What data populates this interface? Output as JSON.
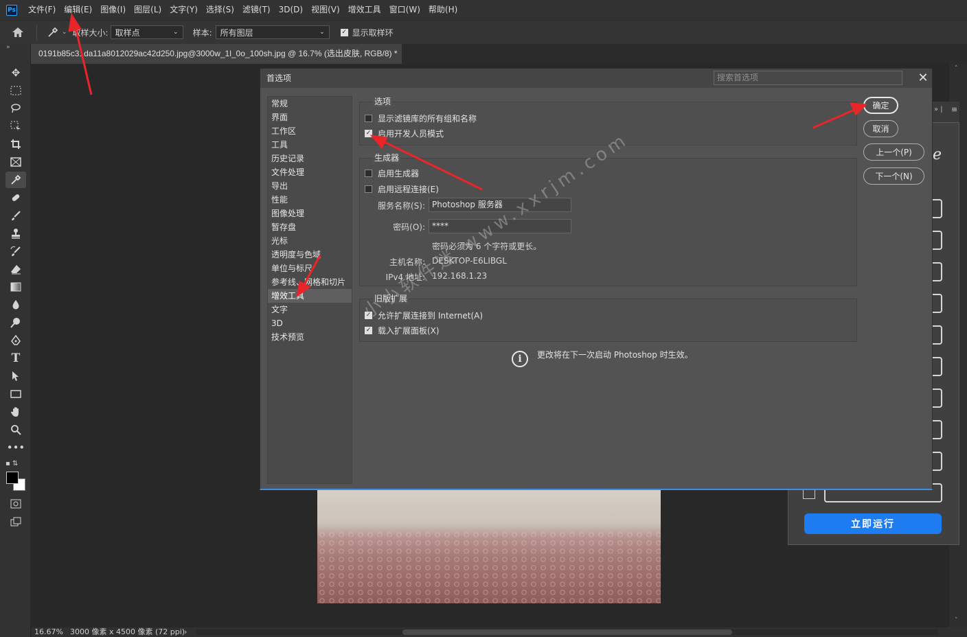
{
  "app": {
    "logo": "Ps"
  },
  "menubar": {
    "items": [
      "文件(F)",
      "编辑(E)",
      "图像(I)",
      "图层(L)",
      "文字(Y)",
      "选择(S)",
      "滤镜(T)",
      "3D(D)",
      "视图(V)",
      "增效工具",
      "窗口(W)",
      "帮助(H)"
    ]
  },
  "options": {
    "home_icon": "home-icon",
    "eyedropper_icon": "eyedropper-icon",
    "sample_size_label": "取样大小:",
    "sample_size_value": "取样点",
    "sample_label": "样本:",
    "sample_value": "所有图层",
    "show_ring_label": "显示取样环",
    "show_ring_checked": true
  },
  "document": {
    "tab_title": "0191b85c31da11a8012029ac42d250.jpg@3000w_1l_0o_100sh.jpg @ 16.7% (选出皮肤, RGB/8) *",
    "tab_close": "×"
  },
  "status": {
    "zoom": "16.67%",
    "doc_info": "3000 像素 x 4500 像素 (72 ppi)",
    "arrow": "›"
  },
  "side_panel": {
    "run_button": "立即运行"
  },
  "dialog": {
    "title": "首选项",
    "search_placeholder": "搜索首选项",
    "close": "✕",
    "nav": [
      "常规",
      "界面",
      "工作区",
      "工具",
      "历史记录",
      "文件处理",
      "导出",
      "性能",
      "图像处理",
      "暂存盘",
      "光标",
      "透明度与色域",
      "单位与标尺",
      "参考线、网格和切片",
      "增效工具",
      "文字",
      "3D",
      "技术预览"
    ],
    "selected_nav": "增效工具",
    "options_group": {
      "title": "选项",
      "show_filter_gallery": {
        "label": "显示滤镜库的所有组和名称",
        "checked": false
      },
      "developer_mode": {
        "label": "启用开发人员模式",
        "checked": true
      }
    },
    "generator_group": {
      "title": "生成器",
      "enable_generator": {
        "label": "启用生成器",
        "checked": false
      },
      "enable_remote": {
        "label": "启用远程连接(E)",
        "checked": false
      },
      "service_name_label": "服务名称(S):",
      "service_name_value": "Photoshop 服务器",
      "password_label": "密码(O):",
      "password_value": "****",
      "password_hint": "密码必须为 6 个字符或更长。",
      "host_label": "主机名称:",
      "host_value": "DESKTOP-E6LIBGL",
      "ipv4_label": "IPv4 地址:",
      "ipv4_value": "192.168.1.23"
    },
    "legacy_group": {
      "title": "旧版扩展",
      "allow_internet": {
        "label": "允许扩展连接到 Internet(A)",
        "checked": true
      },
      "load_panels": {
        "label": "载入扩展面板(X)",
        "checked": true
      }
    },
    "notice": "更改将在下一次启动 Photoshop 时生效。",
    "buttons": {
      "ok": "确定",
      "cancel": "取消",
      "prev": "上一个(P)",
      "next": "下一个(N)"
    }
  },
  "watermark": "小小软件迷 www.xxrjm.com",
  "colors": {
    "accent": "#3d8ee8",
    "annotation_arrow": "#e8262a",
    "run_button": "#1e7cf2"
  }
}
